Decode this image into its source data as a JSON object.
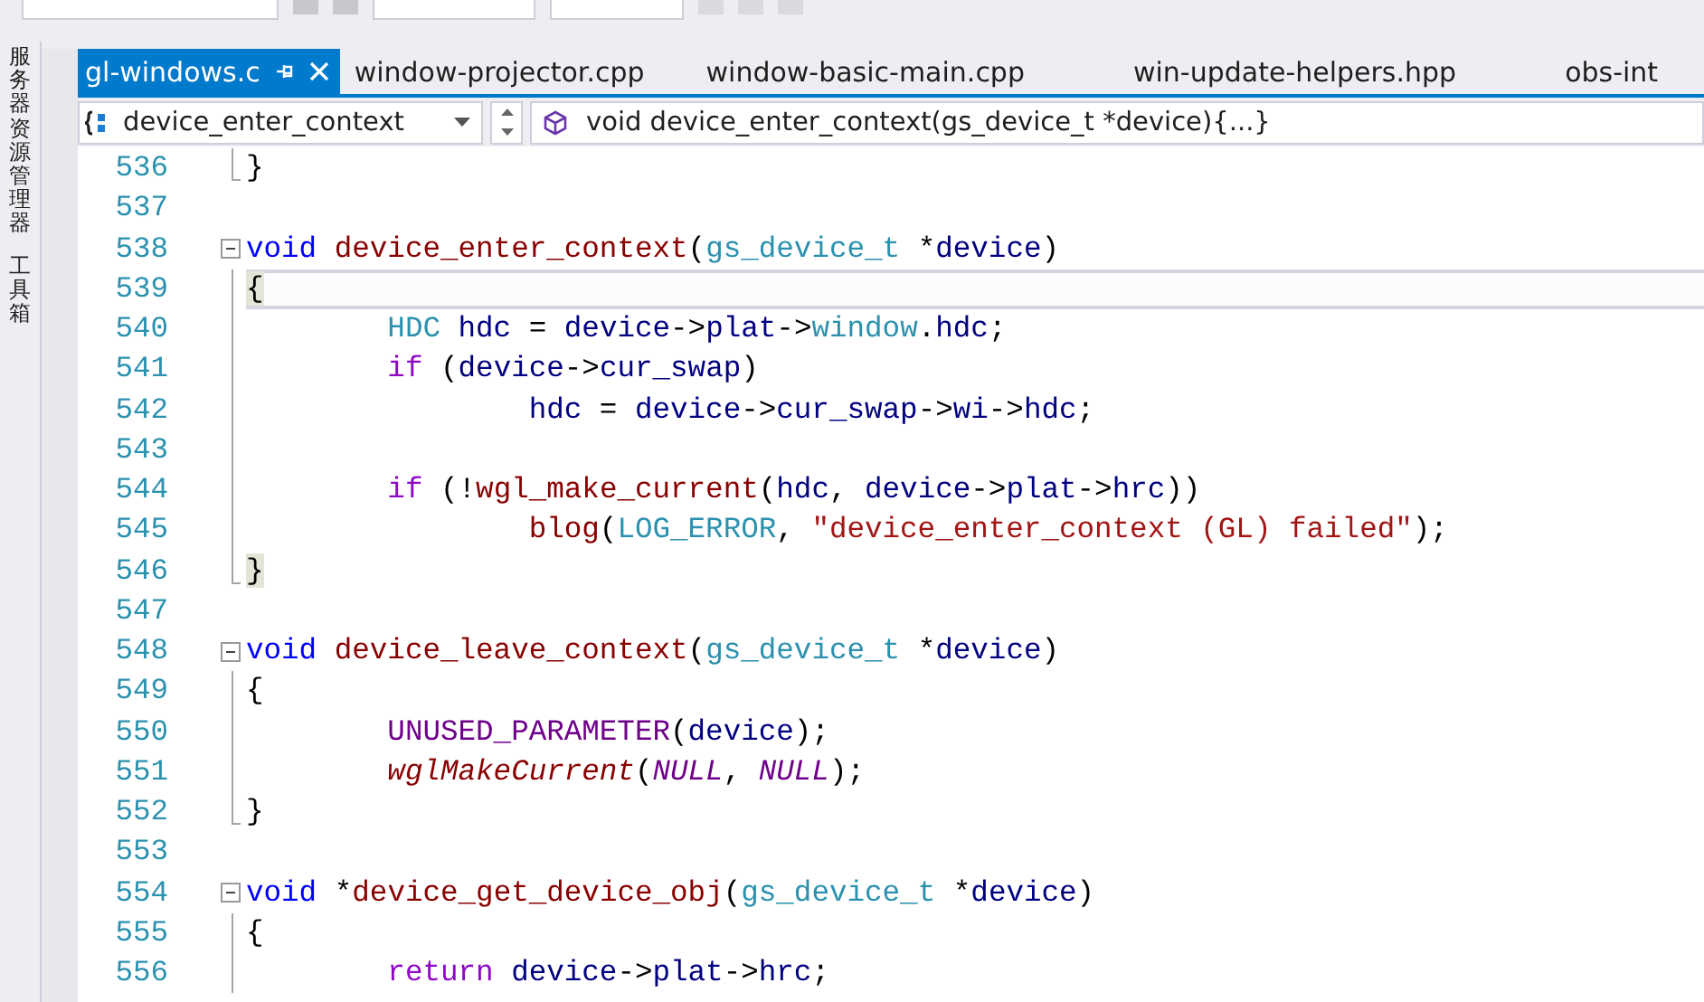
{
  "side_panel": {
    "items": [
      "服务器资源管理器",
      "工具箱"
    ]
  },
  "tabs": [
    {
      "label": "gl-windows.c",
      "selected": true
    },
    {
      "label": "window-projector.cpp",
      "selected": false
    },
    {
      "label": "window-basic-main.cpp",
      "selected": false
    },
    {
      "label": "win-update-helpers.hpp",
      "selected": false
    },
    {
      "label": "obs-int",
      "selected": false
    }
  ],
  "navigation_bar": {
    "scope": "device_enter_context",
    "member": "void device_enter_context(gs_device_t *device){...}"
  },
  "editor": {
    "lines": [
      {
        "number": "536",
        "kind": "fold-end",
        "current": false,
        "tokens": [
          {
            "text": "}",
            "kind": "plain"
          }
        ]
      },
      {
        "number": "537",
        "kind": "plain",
        "current": false
      },
      {
        "number": "538",
        "kind": "fold-start",
        "current": false,
        "tokens": [
          {
            "text": "void",
            "kind": "keyword"
          },
          {
            "text": " device_enter_context",
            "kind": "function"
          },
          {
            "text": "(",
            "kind": "plain"
          },
          {
            "text": "gs_device_t",
            "kind": "type"
          },
          {
            "text": " *",
            "kind": "plain"
          },
          {
            "text": "device",
            "kind": "variable"
          },
          {
            "text": ")",
            "kind": "plain"
          }
        ]
      },
      {
        "number": "539",
        "kind": "fold-body",
        "current": true,
        "tokens": [
          {
            "text": "{",
            "kind": "match"
          }
        ]
      },
      {
        "number": "540",
        "kind": "fold-body",
        "current": false,
        "tokens": [
          {
            "text": "\tHDC",
            "kind": "type"
          },
          {
            "text": " hdc",
            "kind": "variable"
          },
          {
            "text": " = ",
            "kind": "plain"
          },
          {
            "text": "device",
            "kind": "variable"
          },
          {
            "text": "->",
            "kind": "plain"
          },
          {
            "text": "plat",
            "kind": "variable"
          },
          {
            "text": "->",
            "kind": "plain"
          },
          {
            "text": "window",
            "kind": "type"
          },
          {
            "text": ".",
            "kind": "plain"
          },
          {
            "text": "hdc",
            "kind": "variable"
          },
          {
            "text": ";",
            "kind": "plain"
          }
        ]
      },
      {
        "number": "541",
        "kind": "fold-body",
        "current": false,
        "tokens": [
          {
            "text": "\tif",
            "kind": "control"
          },
          {
            "text": " (",
            "kind": "plain"
          },
          {
            "text": "device",
            "kind": "variable"
          },
          {
            "text": "->",
            "kind": "plain"
          },
          {
            "text": "cur_swap",
            "kind": "variable"
          },
          {
            "text": ")",
            "kind": "plain"
          }
        ]
      },
      {
        "number": "542",
        "kind": "fold-body",
        "current": false,
        "tokens": [
          {
            "text": "\t\thdc",
            "kind": "variable"
          },
          {
            "text": " = ",
            "kind": "plain"
          },
          {
            "text": "device",
            "kind": "variable"
          },
          {
            "text": "->",
            "kind": "plain"
          },
          {
            "text": "cur_swap",
            "kind": "variable"
          },
          {
            "text": "->",
            "kind": "plain"
          },
          {
            "text": "wi",
            "kind": "variable"
          },
          {
            "text": "->",
            "kind": "plain"
          },
          {
            "text": "hdc",
            "kind": "variable"
          },
          {
            "text": ";",
            "kind": "plain"
          }
        ]
      },
      {
        "number": "543",
        "kind": "fold-body",
        "current": false
      },
      {
        "number": "544",
        "kind": "fold-body",
        "current": false,
        "tokens": [
          {
            "text": "\tif",
            "kind": "control"
          },
          {
            "text": " (!",
            "kind": "plain"
          },
          {
            "text": "wgl_make_current",
            "kind": "function"
          },
          {
            "text": "(",
            "kind": "plain"
          },
          {
            "text": "hdc",
            "kind": "variable"
          },
          {
            "text": ", ",
            "kind": "plain"
          },
          {
            "text": "device",
            "kind": "variable"
          },
          {
            "text": "->",
            "kind": "plain"
          },
          {
            "text": "plat",
            "kind": "variable"
          },
          {
            "text": "->",
            "kind": "plain"
          },
          {
            "text": "hrc",
            "kind": "variable"
          },
          {
            "text": "))",
            "kind": "plain"
          }
        ]
      },
      {
        "number": "545",
        "kind": "fold-body",
        "current": false,
        "tokens": [
          {
            "text": "\t\tblog",
            "kind": "function"
          },
          {
            "text": "(",
            "kind": "plain"
          },
          {
            "text": "LOG_ERROR",
            "kind": "type"
          },
          {
            "text": ", ",
            "kind": "plain"
          },
          {
            "text": "\"device_enter_context (GL) failed\"",
            "kind": "string"
          },
          {
            "text": ");",
            "kind": "plain"
          }
        ]
      },
      {
        "number": "546",
        "kind": "fold-end",
        "current": false,
        "tokens": [
          {
            "text": "}",
            "kind": "match"
          }
        ]
      },
      {
        "number": "547",
        "kind": "plain",
        "current": false
      },
      {
        "number": "548",
        "kind": "fold-start",
        "current": false,
        "tokens": [
          {
            "text": "void",
            "kind": "keyword"
          },
          {
            "text": " device_leave_context",
            "kind": "function"
          },
          {
            "text": "(",
            "kind": "plain"
          },
          {
            "text": "gs_device_t",
            "kind": "type"
          },
          {
            "text": " *",
            "kind": "plain"
          },
          {
            "text": "device",
            "kind": "variable"
          },
          {
            "text": ")",
            "kind": "plain"
          }
        ]
      },
      {
        "number": "549",
        "kind": "fold-body",
        "current": false,
        "tokens": [
          {
            "text": "{",
            "kind": "plain"
          }
        ]
      },
      {
        "number": "550",
        "kind": "fold-body",
        "current": false,
        "tokens": [
          {
            "text": "\tUNUSED_PARAMETER",
            "kind": "macro"
          },
          {
            "text": "(",
            "kind": "plain"
          },
          {
            "text": "device",
            "kind": "variable"
          },
          {
            "text": ");",
            "kind": "plain"
          }
        ]
      },
      {
        "number": "551",
        "kind": "fold-body",
        "current": false,
        "tokens": [
          {
            "text": "\twglMakeCurrent",
            "kind": "italic-function"
          },
          {
            "text": "(",
            "kind": "plain"
          },
          {
            "text": "NULL",
            "kind": "italic-macro"
          },
          {
            "text": ", ",
            "kind": "plain"
          },
          {
            "text": "NULL",
            "kind": "italic-macro"
          },
          {
            "text": ");",
            "kind": "plain"
          }
        ]
      },
      {
        "number": "552",
        "kind": "fold-end",
        "current": false,
        "tokens": [
          {
            "text": "}",
            "kind": "plain"
          }
        ]
      },
      {
        "number": "553",
        "kind": "plain",
        "current": false
      },
      {
        "number": "554",
        "kind": "fold-start",
        "current": false,
        "tokens": [
          {
            "text": "void",
            "kind": "keyword"
          },
          {
            "text": " *",
            "kind": "plain"
          },
          {
            "text": "device_get_device_obj",
            "kind": "function"
          },
          {
            "text": "(",
            "kind": "plain"
          },
          {
            "text": "gs_device_t",
            "kind": "type"
          },
          {
            "text": " *",
            "kind": "plain"
          },
          {
            "text": "device",
            "kind": "variable"
          },
          {
            "text": ")",
            "kind": "plain"
          }
        ]
      },
      {
        "number": "555",
        "kind": "fold-body",
        "current": false,
        "tokens": [
          {
            "text": "{",
            "kind": "plain"
          }
        ]
      },
      {
        "number": "556",
        "kind": "fold-body",
        "current": false,
        "tokens": [
          {
            "text": "\treturn",
            "kind": "control"
          },
          {
            "text": " device",
            "kind": "variable"
          },
          {
            "text": "->",
            "kind": "plain"
          },
          {
            "text": "plat",
            "kind": "variable"
          },
          {
            "text": "->",
            "kind": "plain"
          },
          {
            "text": "hrc",
            "kind": "variable"
          },
          {
            "text": ";",
            "kind": "plain"
          }
        ]
      }
    ]
  }
}
